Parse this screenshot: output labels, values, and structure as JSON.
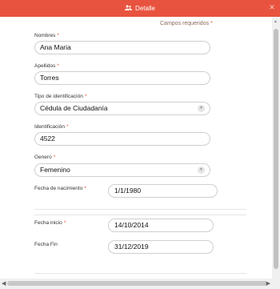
{
  "header": {
    "title": "Detalle",
    "title_icon": "users-icon",
    "close_icon": "close-icon"
  },
  "form": {
    "required_note": "Campos requeridos",
    "required_star": "*",
    "nombres": {
      "label": "Nombres",
      "value": "Ana Maria"
    },
    "apellidos": {
      "label": "Apellidos",
      "value": "Torres"
    },
    "tipo_id": {
      "label": "Tipo de identificación",
      "value": "Cédula de Ciudadanía"
    },
    "identificacion": {
      "label": "Identificación",
      "value": "4522"
    },
    "genero": {
      "label": "Genero",
      "value": "Femenino"
    },
    "fecha_nacimiento": {
      "label": "Fecha de nacimiento",
      "value": "1/1/1980"
    },
    "fecha_inicio": {
      "label": "Fecha inicio",
      "value": "14/10/2014"
    },
    "fecha_fin": {
      "label": "Fecha Fin",
      "value": "31/12/2019"
    }
  },
  "colors": {
    "header": "#e8533f",
    "required_star": "#e8533f"
  }
}
